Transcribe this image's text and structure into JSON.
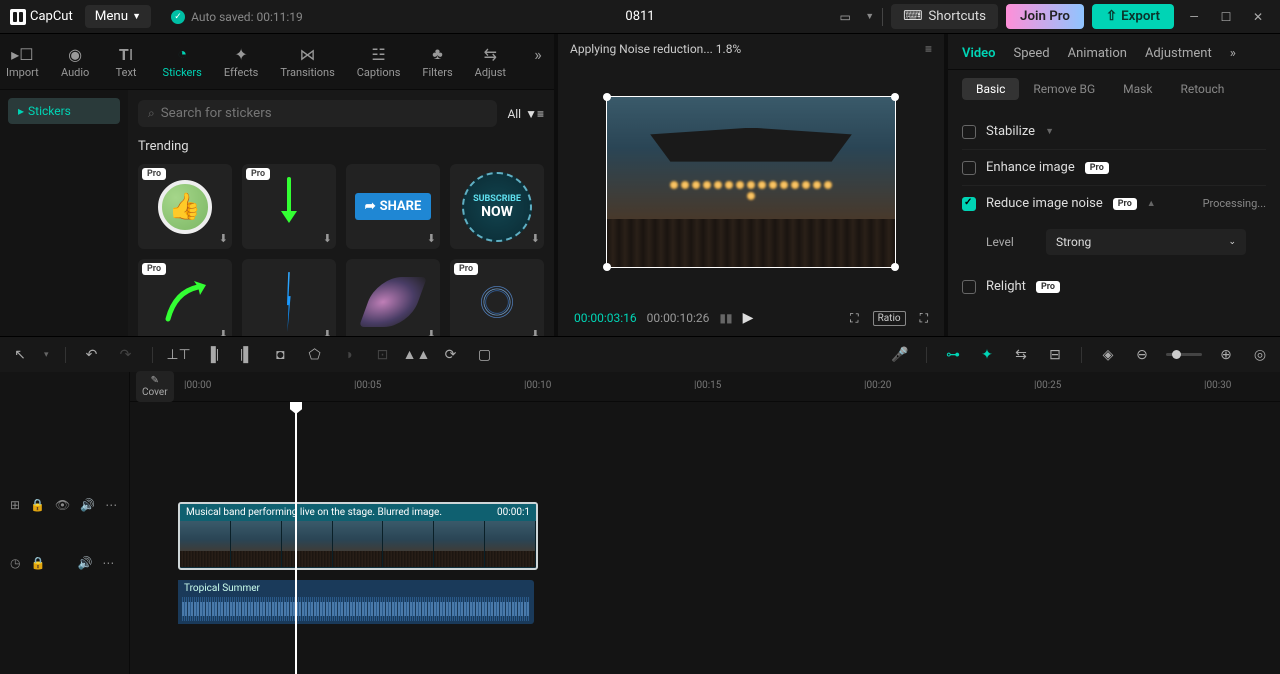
{
  "titlebar": {
    "app": "CapCut",
    "menu": "Menu",
    "autosave": "Auto saved: 00:11:19",
    "project": "0811",
    "shortcuts": "Shortcuts",
    "joinpro": "Join Pro",
    "export": "Export"
  },
  "mediaTabs": [
    "Import",
    "Audio",
    "Text",
    "Stickers",
    "Effects",
    "Transitions",
    "Captions",
    "Filters",
    "Adjust"
  ],
  "activeTab": "Stickers",
  "stickersSide": "Stickers",
  "search": {
    "placeholder": "Search for stickers",
    "filter": "All"
  },
  "trending": "Trending",
  "stickers": [
    {
      "name": "thumbs-up",
      "pro": true
    },
    {
      "name": "arrow-down",
      "pro": true
    },
    {
      "name": "share",
      "pro": false,
      "label": "SHARE"
    },
    {
      "name": "subscribe",
      "pro": false,
      "l1": "SUBSCRIBE",
      "l2": "NOW"
    },
    {
      "name": "arrow-curve",
      "pro": true
    },
    {
      "name": "lightning",
      "pro": false
    },
    {
      "name": "wing",
      "pro": false
    },
    {
      "name": "firework",
      "pro": true
    }
  ],
  "preview": {
    "status": "Applying Noise reduction... 1.8%",
    "current": "00:00:03:16",
    "total": "00:00:10:26",
    "ratio": "Ratio"
  },
  "rightPanel": {
    "tabs": [
      "Video",
      "Speed",
      "Animation",
      "Adjustment"
    ],
    "subtabs": [
      "Basic",
      "Remove BG",
      "Mask",
      "Retouch"
    ],
    "stabilize": "Stabilize",
    "enhance": "Enhance image",
    "reduce": "Reduce image noise",
    "processing": "Processing...",
    "levelLabel": "Level",
    "levelValue": "Strong",
    "relight": "Relight",
    "pro": "Pro"
  },
  "ruler": [
    "00:00",
    "00:05",
    "00:10",
    "00:15",
    "00:20",
    "00:25",
    "00:30"
  ],
  "clip": {
    "title": "Musical band performing live on the stage. Blurred image.",
    "dur": "00:00:1"
  },
  "audio": {
    "title": "Tropical Summer"
  },
  "cover": "Cover"
}
